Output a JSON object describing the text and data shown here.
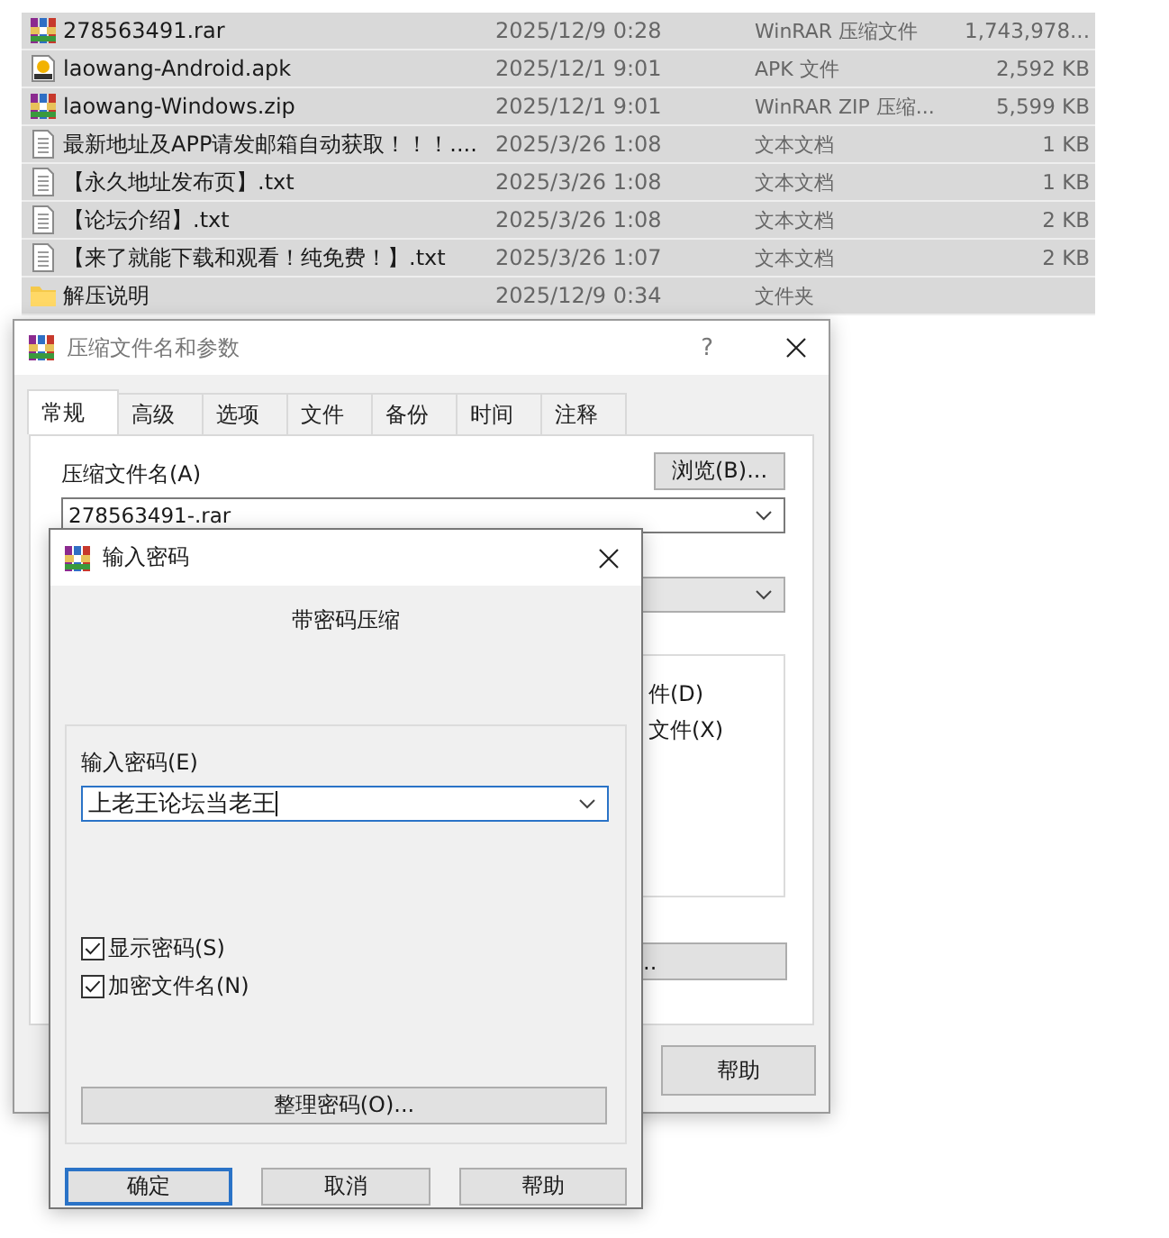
{
  "files": [
    {
      "name": "278563491.rar",
      "modified": "2025/12/9 0:28",
      "type": "WinRAR 压缩文件",
      "size": "1,743,978...",
      "kind": "rar",
      "selected": true
    },
    {
      "name": "laowang-Android.apk",
      "modified": "2025/12/1 9:01",
      "type": "APK 文件",
      "size": "2,592 KB",
      "kind": "apk",
      "selected": true
    },
    {
      "name": "laowang-Windows.zip",
      "modified": "2025/12/1 9:01",
      "type": "WinRAR ZIP 压缩...",
      "size": "5,599 KB",
      "kind": "rar",
      "selected": true
    },
    {
      "name": "最新地址及APP请发邮箱自动获取！！！....",
      "modified": "2025/3/26 1:08",
      "type": "文本文档",
      "size": "1 KB",
      "kind": "txt",
      "selected": true
    },
    {
      "name": "【永久地址发布页】.txt",
      "modified": "2025/3/26 1:08",
      "type": "文本文档",
      "size": "1 KB",
      "kind": "txt",
      "selected": true
    },
    {
      "name": "【论坛介绍】.txt",
      "modified": "2025/3/26 1:08",
      "type": "文本文档",
      "size": "2 KB",
      "kind": "txt",
      "selected": true
    },
    {
      "name": "【来了就能下载和观看！纯免费！】.txt",
      "modified": "2025/3/26 1:07",
      "type": "文本文档",
      "size": "2 KB",
      "kind": "txt",
      "selected": true
    },
    {
      "name": "解压说明",
      "modified": "2025/12/9 0:34",
      "type": "文件夹",
      "kind": "folder",
      "selected": true
    }
  ],
  "archive_dialog": {
    "title": "压缩文件名和参数",
    "help_glyph": "?",
    "tabs": [
      {
        "label": "常规",
        "selected": true
      },
      {
        "label": "高级",
        "selected": false
      },
      {
        "label": "选项",
        "selected": false
      },
      {
        "label": "文件",
        "selected": false
      },
      {
        "label": "备份",
        "selected": false
      },
      {
        "label": "时间",
        "selected": false
      },
      {
        "label": "注释",
        "selected": false
      }
    ],
    "archive_name_label": "压缩文件名(A)",
    "browse_button": "浏览(B)...",
    "archive_name": "278563491-.rar",
    "option_texts": [
      "件(D)",
      "文件(X)"
    ],
    "partial_button": "..",
    "help_button": "帮助"
  },
  "password_dialog": {
    "title": "输入密码",
    "heading": "带密码压缩",
    "password_label": "输入密码(E)",
    "password": "上老王论坛当老王",
    "checkboxes": [
      {
        "label": "显示密码(S)",
        "checked": true
      },
      {
        "label": "加密文件名(N)",
        "checked": true
      }
    ],
    "organize_button": "整理密码(O)...",
    "buttons": [
      {
        "label": "确定",
        "default": true
      },
      {
        "label": "取消",
        "default": false
      },
      {
        "label": "帮助",
        "default": false
      }
    ]
  }
}
